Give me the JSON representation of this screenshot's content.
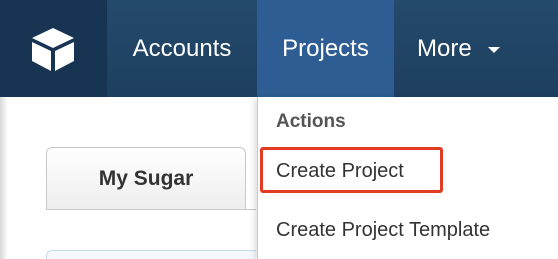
{
  "navbar": {
    "logo_icon": "cube-icon",
    "items": [
      {
        "label": "Accounts"
      },
      {
        "label": "Projects"
      },
      {
        "label": "More"
      }
    ]
  },
  "tabs": {
    "my_sugar": "My Sugar"
  },
  "dropdown": {
    "heading": "Actions",
    "items": [
      {
        "label": "Create Project",
        "highlighted": true
      },
      {
        "label": "Create Project Template"
      }
    ]
  },
  "colors": {
    "navbar": "#244a6c",
    "logo_bg": "#173453",
    "active_tab": "#2d5d93",
    "highlight": "#e23a23"
  }
}
